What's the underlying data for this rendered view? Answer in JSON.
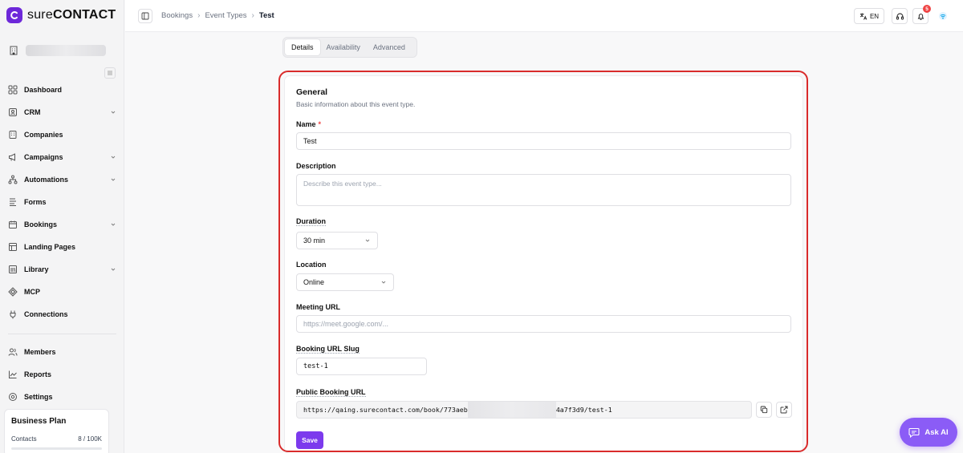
{
  "brand": {
    "name_light": "sure",
    "name_bold": "CONTACT",
    "accent": "#7c3aed"
  },
  "sidebar": {
    "items": [
      {
        "label": "Dashboard",
        "icon": "dashboard-icon",
        "expandable": false
      },
      {
        "label": "CRM",
        "icon": "contact-card-icon",
        "expandable": true
      },
      {
        "label": "Companies",
        "icon": "building-icon",
        "expandable": false
      },
      {
        "label": "Campaigns",
        "icon": "megaphone-icon",
        "expandable": true
      },
      {
        "label": "Automations",
        "icon": "workflow-icon",
        "expandable": true
      },
      {
        "label": "Forms",
        "icon": "form-icon",
        "expandable": false
      },
      {
        "label": "Bookings",
        "icon": "calendar-icon",
        "expandable": true
      },
      {
        "label": "Landing Pages",
        "icon": "layout-icon",
        "expandable": false
      },
      {
        "label": "Library",
        "icon": "library-icon",
        "expandable": true
      },
      {
        "label": "MCP",
        "icon": "mcp-icon",
        "expandable": false
      },
      {
        "label": "Connections",
        "icon": "plug-icon",
        "expandable": false
      }
    ],
    "bottom_items": [
      {
        "label": "Members",
        "icon": "users-icon"
      },
      {
        "label": "Reports",
        "icon": "chart-line-icon"
      },
      {
        "label": "Settings",
        "icon": "gear-icon"
      }
    ],
    "plan": {
      "title": "Business Plan",
      "contacts_label": "Contacts",
      "contacts_value": "8 / 100K"
    }
  },
  "header": {
    "breadcrumbs": [
      "Bookings",
      "Event Types",
      "Test"
    ],
    "language": "EN",
    "notification_count": "5"
  },
  "tabs": [
    {
      "label": "Details",
      "active": true
    },
    {
      "label": "Availability",
      "active": false
    },
    {
      "label": "Advanced",
      "active": false
    }
  ],
  "form": {
    "title": "General",
    "subtitle": "Basic information about this event type.",
    "name_label": "Name",
    "name_required": "*",
    "name_value": "Test",
    "description_label": "Description",
    "description_placeholder": "Describe this event type...",
    "duration_label": "Duration",
    "duration_value": "30 min",
    "location_label": "Location",
    "location_value": "Online",
    "meeting_url_label": "Meeting URL",
    "meeting_url_placeholder": "https://meet.google.com/...",
    "slug_label": "Booking URL Slug",
    "slug_value": "test-1",
    "public_url_label": "Public Booking URL",
    "public_url_prefix": "https://qaing.surecontact.com/book/773aeb",
    "public_url_suffix": "4a7f3d9/test-1",
    "save_label": "Save"
  },
  "ask_ai": {
    "label": "Ask AI"
  }
}
